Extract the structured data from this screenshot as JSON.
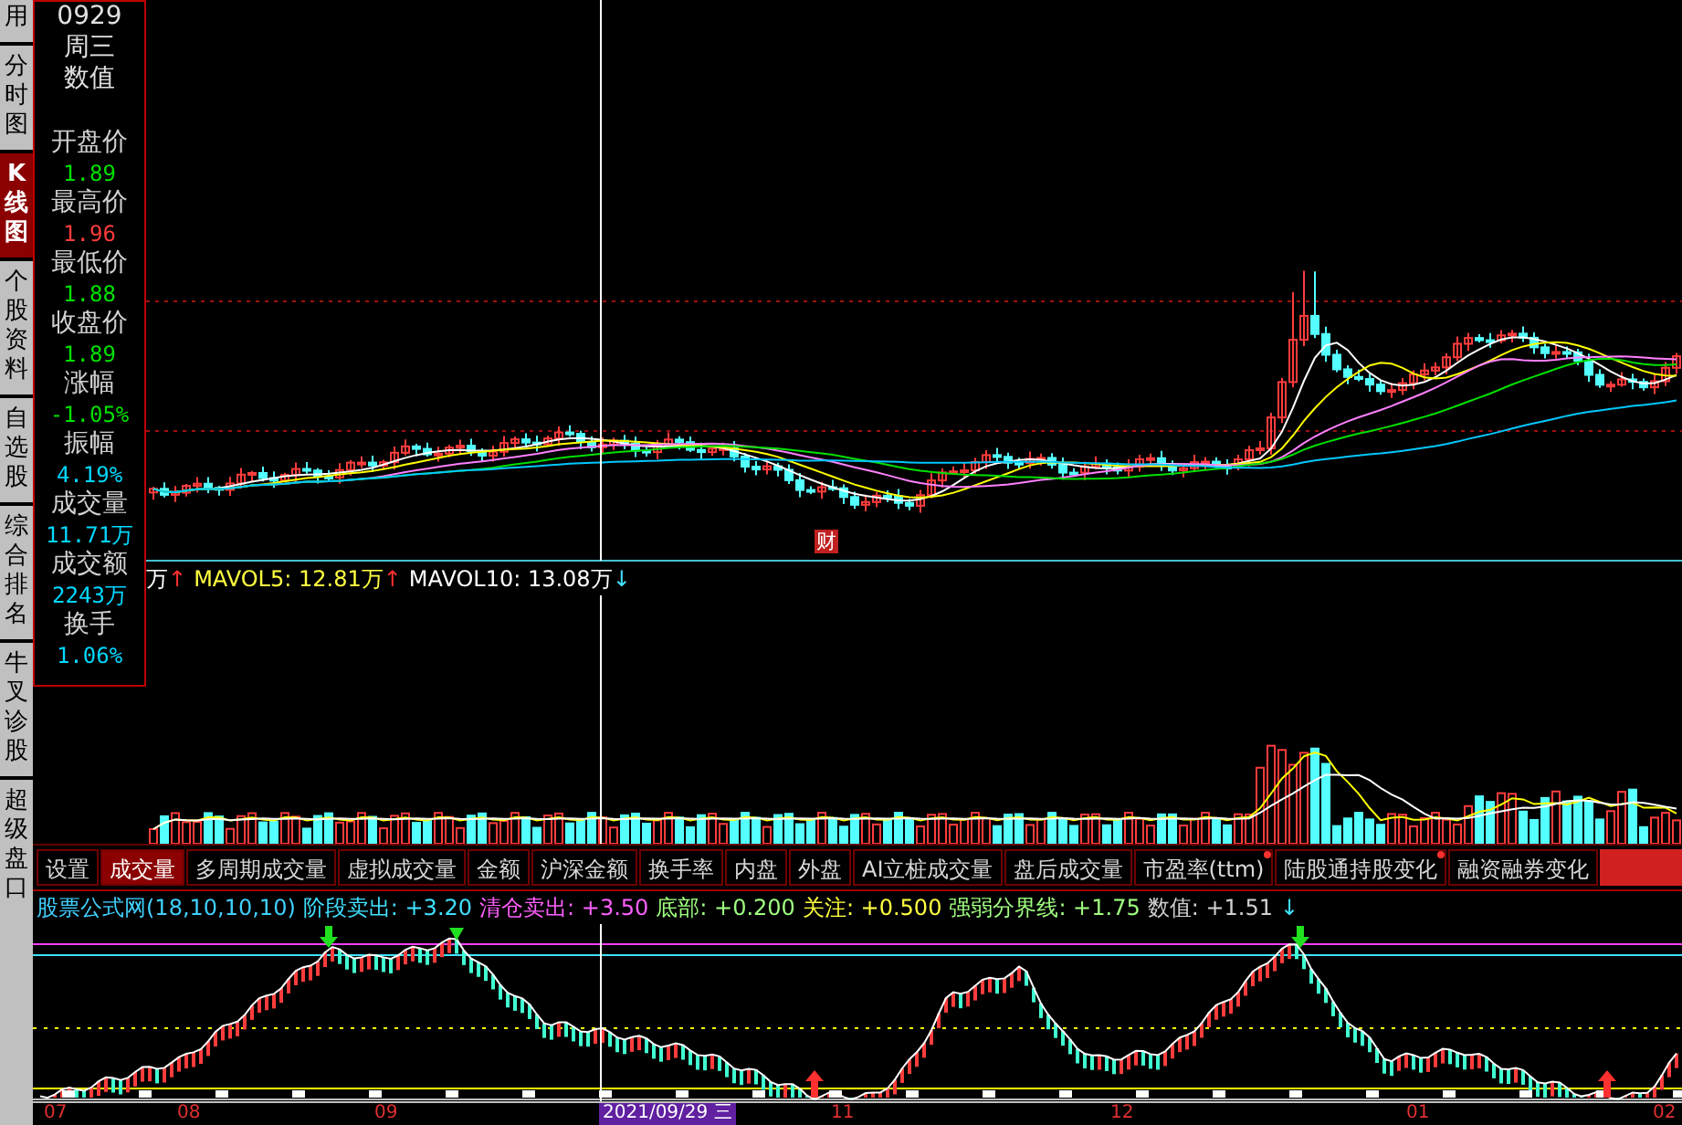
{
  "sidebar": {
    "items": [
      {
        "label": "用",
        "selected": false
      },
      {
        "label": "分时图",
        "selected": false
      },
      {
        "label": "K线图",
        "selected": true
      },
      {
        "label": "个股资料",
        "selected": false
      },
      {
        "label": "自选股",
        "selected": false
      },
      {
        "label": "综合排名",
        "selected": false
      },
      {
        "label": "牛叉诊股",
        "selected": false
      },
      {
        "label": "超级盘口",
        "selected": false
      }
    ]
  },
  "info_panel": {
    "header": [
      "0929",
      "周三",
      "数值"
    ],
    "fields": [
      {
        "label": "开盘价",
        "value": "1.89",
        "color": "#00e000"
      },
      {
        "label": "最高价",
        "value": "1.96",
        "color": "#ff3c3c"
      },
      {
        "label": "最低价",
        "value": "1.88",
        "color": "#00e000"
      },
      {
        "label": "收盘价",
        "value": "1.89",
        "color": "#00e000"
      },
      {
        "label": "涨幅",
        "value": "-1.05%",
        "color": "#00e000"
      },
      {
        "label": "振幅",
        "value": "4.19%",
        "color": "#00d8ff"
      },
      {
        "label": "成交量",
        "value": "11.71万",
        "color": "#00d8ff"
      },
      {
        "label": "成交额",
        "value": "2243万",
        "color": "#00d8ff"
      },
      {
        "label": "换手",
        "value": "1.06%",
        "color": "#00d8ff"
      }
    ]
  },
  "price_chart": {
    "event_marker": "财"
  },
  "volume_chart": {
    "legend": [
      {
        "text": "万",
        "arrow": "↑",
        "rising": true,
        "color": "#ffffff"
      },
      {
        "text": "MAVOL5: 12.81万",
        "arrow": "↑",
        "rising": true,
        "color": "#ffff40"
      },
      {
        "text": "MAVOL10: 13.08万",
        "arrow": "↓",
        "rising": false,
        "color": "#ffffff"
      }
    ]
  },
  "indicator_tabs": [
    {
      "label": "设置",
      "selected": false,
      "marked": false
    },
    {
      "label": "成交量",
      "selected": true,
      "marked": false
    },
    {
      "label": "多周期成交量",
      "selected": false,
      "marked": false
    },
    {
      "label": "虚拟成交量",
      "selected": false,
      "marked": false
    },
    {
      "label": "金额",
      "selected": false,
      "marked": false
    },
    {
      "label": "沪深金额",
      "selected": false,
      "marked": false
    },
    {
      "label": "换手率",
      "selected": false,
      "marked": false
    },
    {
      "label": "内盘",
      "selected": false,
      "marked": false
    },
    {
      "label": "外盘",
      "selected": false,
      "marked": false
    },
    {
      "label": "AI立桩成交量",
      "selected": false,
      "marked": false
    },
    {
      "label": "盘后成交量",
      "selected": false,
      "marked": false
    },
    {
      "label": "市盈率(ttm)",
      "selected": false,
      "marked": true
    },
    {
      "label": "陆股通持股变化",
      "selected": false,
      "marked": true
    },
    {
      "label": "融资融券变化",
      "selected": false,
      "marked": false
    }
  ],
  "indicator": {
    "title": "股票公式网(18,10,10,10)",
    "values": [
      {
        "text": "阶段卖出: +3.20",
        "color": "#40e0ff"
      },
      {
        "text": "清仓卖出: +3.50",
        "color": "#ff60ff"
      },
      {
        "text": "底部: +0.200",
        "color": "#a0ff80"
      },
      {
        "text": "关注: +0.500",
        "color": "#ffff40"
      },
      {
        "text": "强弱分界线: +1.75",
        "color": "#a0ff80"
      },
      {
        "text": "数值: +1.51",
        "color": "#d0d0d0"
      }
    ],
    "arrow": "↓",
    "rising": false
  },
  "date_axis": [
    {
      "label": "07",
      "highlighted": false
    },
    {
      "label": "08",
      "highlighted": false
    },
    {
      "label": "09",
      "highlighted": false
    },
    {
      "label": "2021/09/29 三",
      "highlighted": true
    },
    {
      "label": "11",
      "highlighted": false
    },
    {
      "label": "12",
      "highlighted": false
    },
    {
      "label": "01",
      "highlighted": false
    },
    {
      "label": "02",
      "highlighted": false
    }
  ]
}
